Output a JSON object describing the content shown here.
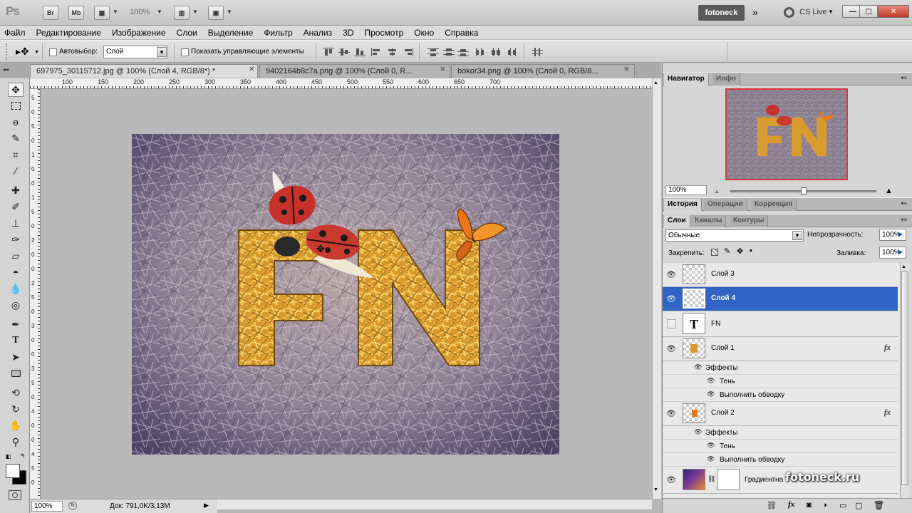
{
  "app": {
    "logo": "Ps",
    "bridge_btn": "Br",
    "minibridge_btn": "Mb",
    "zoom": "100%",
    "workspace": "fotoneck",
    "cslive": "CS Live"
  },
  "menu": [
    "Файл",
    "Редактирование",
    "Изображение",
    "Слои",
    "Выделение",
    "Фильтр",
    "Анализ",
    "3D",
    "Просмотр",
    "Окно",
    "Справка"
  ],
  "options": {
    "autoselect_label": "Автовыбор:",
    "autoselect_value": "Слой",
    "show_controls_label": "Показать управляющие элементы"
  },
  "tabs": [
    {
      "label": "697975_30115712.jpg @ 100% (Слой 4, RGB/8*) *",
      "active": true
    },
    {
      "label": "9402164b8c7a.png @ 100% (Слой 0, R...",
      "active": false
    },
    {
      "label": "bokor34.png @ 100% (Слой 0, RGB/8...",
      "active": false
    }
  ],
  "ruler_h": [
    "100",
    "150",
    "200",
    "250",
    "300",
    "350",
    "400",
    "450",
    "500",
    "550",
    "600",
    "650",
    "700"
  ],
  "ruler_v": [
    "5",
    "0",
    "5",
    "0",
    "1",
    "0",
    "0",
    "1",
    "5",
    "0",
    "2",
    "0",
    "0",
    "2",
    "5",
    "0",
    "3",
    "0",
    "0",
    "3",
    "5",
    "0",
    "4",
    "0",
    "0",
    "4",
    "5",
    "0"
  ],
  "artwork": {
    "text": "FN"
  },
  "status": {
    "zoom": "100%",
    "doc": "Док: 791,0K/3,13M"
  },
  "navigator": {
    "tabs": [
      "Навигатор",
      "Инфо"
    ],
    "zoom": "100%"
  },
  "history_tabs": [
    "История",
    "Операции",
    "Коррекция"
  ],
  "layers_panel": {
    "tabs": [
      "Слои",
      "Каналы",
      "Контуры"
    ],
    "blend_mode": "Обычные",
    "opacity_label": "Непрозрачность:",
    "opacity_value": "100%",
    "lock_label": "Закрепить:",
    "fill_label": "Заливка:",
    "fill_value": "100%",
    "effects_label": "Эффекты",
    "effect_shadow": "Тень",
    "effect_stroke": "Выполнить обводку",
    "layers": [
      {
        "name": "Слой 3",
        "selected": false
      },
      {
        "name": "Слой 4",
        "selected": true
      },
      {
        "name": "FN",
        "selected": false
      },
      {
        "name": "Слой 1",
        "selected": false
      },
      {
        "name": "Слой 2",
        "selected": false
      },
      {
        "name": "Градиентна",
        "selected": false
      }
    ],
    "fx": "fx"
  },
  "watermark": "fotoneck.ru",
  "colors": {
    "selected_layer": "#3164c4",
    "navigator_frame": "#d9363e",
    "straw": "#e0a53a"
  }
}
